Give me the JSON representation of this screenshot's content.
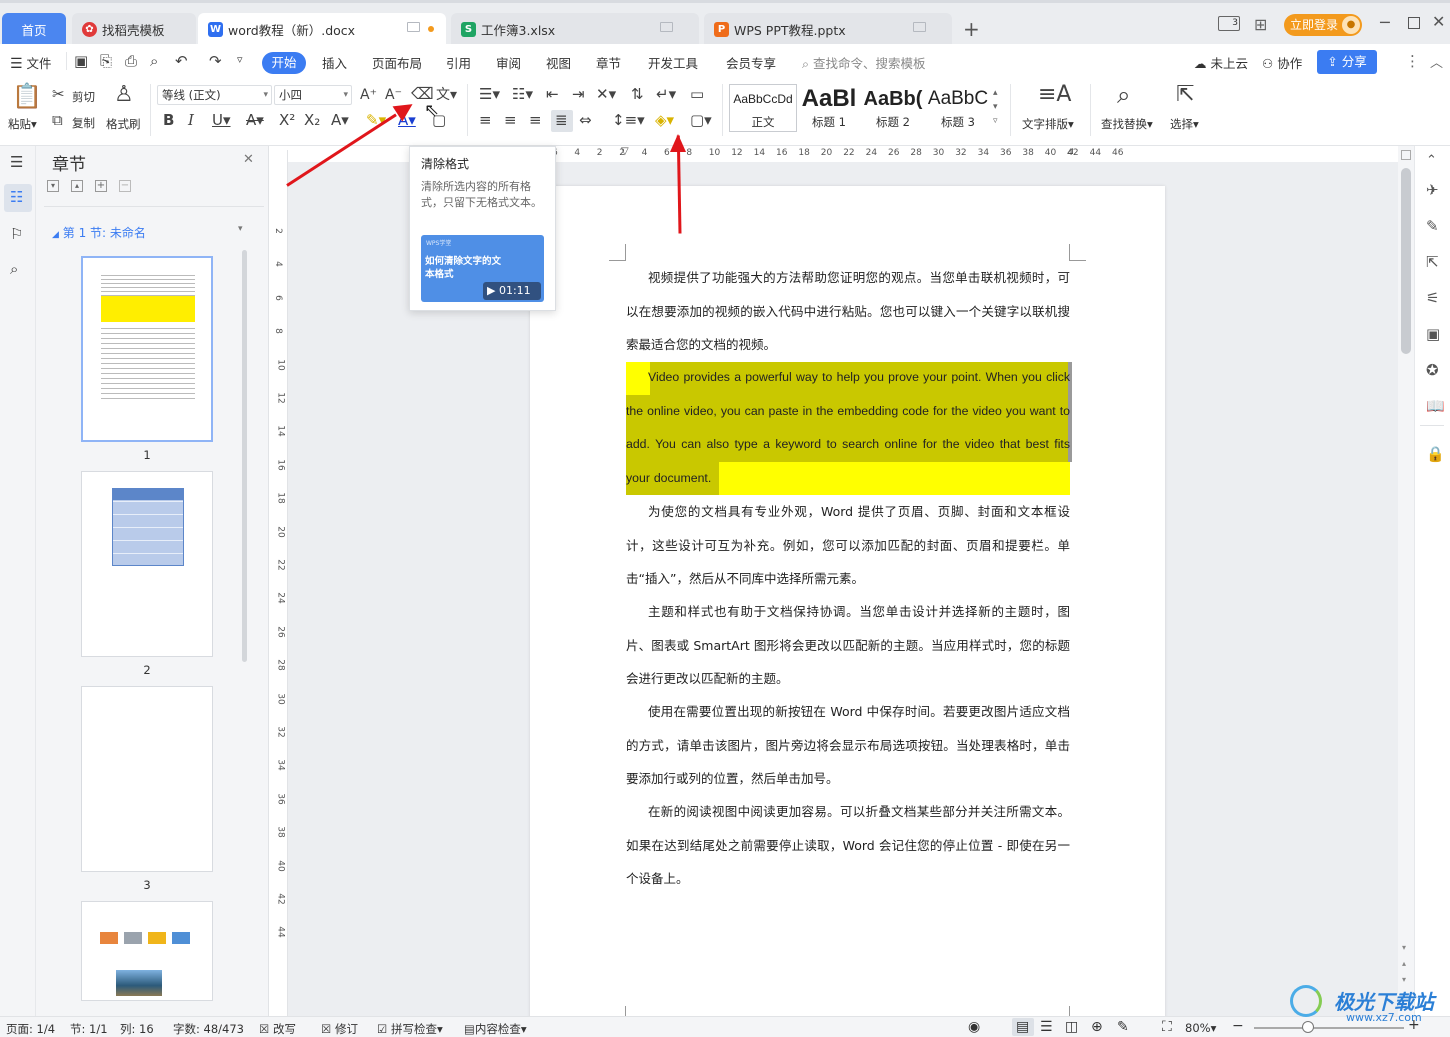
{
  "tabs": {
    "home": "首页",
    "t1": "找稻壳模板",
    "t2": "word教程（新）.docx",
    "t3": "工作簿3.xlsx",
    "t4": "WPS PPT教程.pptx",
    "add": "+",
    "login": "立即登录"
  },
  "menu": {
    "file": "文件",
    "start": "开始",
    "insert": "插入",
    "layout": "页面布局",
    "ref": "引用",
    "review": "审阅",
    "view": "视图",
    "chapter": "章节",
    "dev": "开发工具",
    "member": "会员专享",
    "search": "查找命令、搜索模板",
    "cloud": "未上云",
    "collab": "协作",
    "share": "分享"
  },
  "ribbon": {
    "paste": "粘贴",
    "cut": "剪切",
    "copy": "复制",
    "painter": "格式刷",
    "font": "等线 (正文)",
    "size": "小四",
    "style_normal": "正文",
    "style_h1": "标题 1",
    "style_h2": "标题 2",
    "style_h3": "标题 3",
    "preview_normal": "AaBbCcDd",
    "preview_h1": "AaBl",
    "preview_h2": "AaBb(",
    "preview_h3": "AaBbC",
    "text_layout": "文字排版",
    "find_replace": "查找替换",
    "select": "选择"
  },
  "tooltip": {
    "title": "清除格式",
    "desc": "清除所选内容的所有格式，只留下无格式文本。",
    "video_brand": "WPS学堂",
    "video_title": "如何清除文字的文本格式",
    "duration": "01:11"
  },
  "nav": {
    "title": "章节",
    "section": "第 1 节: 未命名",
    "pages": [
      "1",
      "2",
      "3"
    ]
  },
  "ruler_h": [
    "6",
    "4",
    "2",
    "2",
    "4",
    "6",
    "8",
    "10",
    "12",
    "14",
    "16",
    "18",
    "20",
    "22",
    "24",
    "26",
    "28",
    "30",
    "32",
    "34",
    "36",
    "38",
    "40",
    "42",
    "44",
    "46"
  ],
  "ruler_v": [
    "2",
    "4",
    "6",
    "8",
    "10",
    "12",
    "14",
    "16",
    "18",
    "20",
    "22",
    "24",
    "26",
    "28",
    "30",
    "32",
    "34",
    "36",
    "38",
    "40",
    "42",
    "44"
  ],
  "document": {
    "p1": "视频提供了功能强大的方法帮助您证明您的观点。当您单击联机视频时，可以在想要添加的视频的嵌入代码中进行粘贴。您也可以键入一个关键字以联机搜索最适合您的文档的视频。",
    "p2": "Video provides a powerful way to help you prove your point. When you click the online video, you can paste in the embedding code for the video you want to add. You can also type a keyword to search online for the video that best fits your document.",
    "p3": "为使您的文档具有专业外观，Word 提供了页眉、页脚、封面和文本框设计，这些设计可互为补充。例如，您可以添加匹配的封面、页眉和提要栏。单击“插入”，然后从不同库中选择所需元素。",
    "p4": "主题和样式也有助于文档保持协调。当您单击设计并选择新的主题时，图片、图表或 SmartArt 图形将会更改以匹配新的主题。当应用样式时，您的标题会进行更改以匹配新的主题。",
    "p5": "使用在需要位置出现的新按钮在 Word 中保存时间。若要更改图片适应文档的方式，请单击该图片，图片旁边将会显示布局选项按钮。当处理表格时，单击要添加行或列的位置，然后单击加号。",
    "p6": "在新的阅读视图中阅读更加容易。可以折叠文档某些部分并关注所需文本。如果在达到结尾处之前需要停止读取，Word 会记住您的停止位置 - 即使在另一个设备上。"
  },
  "status": {
    "page": "页面: 1/4",
    "section": "节: 1/1",
    "col": "列: 16",
    "words": "字数: 48/473",
    "overwrite": "改写",
    "track": "修订",
    "spell": "拼写检查",
    "content": "内容检查",
    "zoom": "80%"
  },
  "watermark": {
    "brand": "极光下载站",
    "url": "www.xz7.com"
  },
  "colors": {
    "accent": "#3b7cf2",
    "highlight_olive": "#c9c800",
    "highlight_yellow": "#ffff00",
    "arrow": "#e0161b",
    "login": "#f39a1d"
  }
}
